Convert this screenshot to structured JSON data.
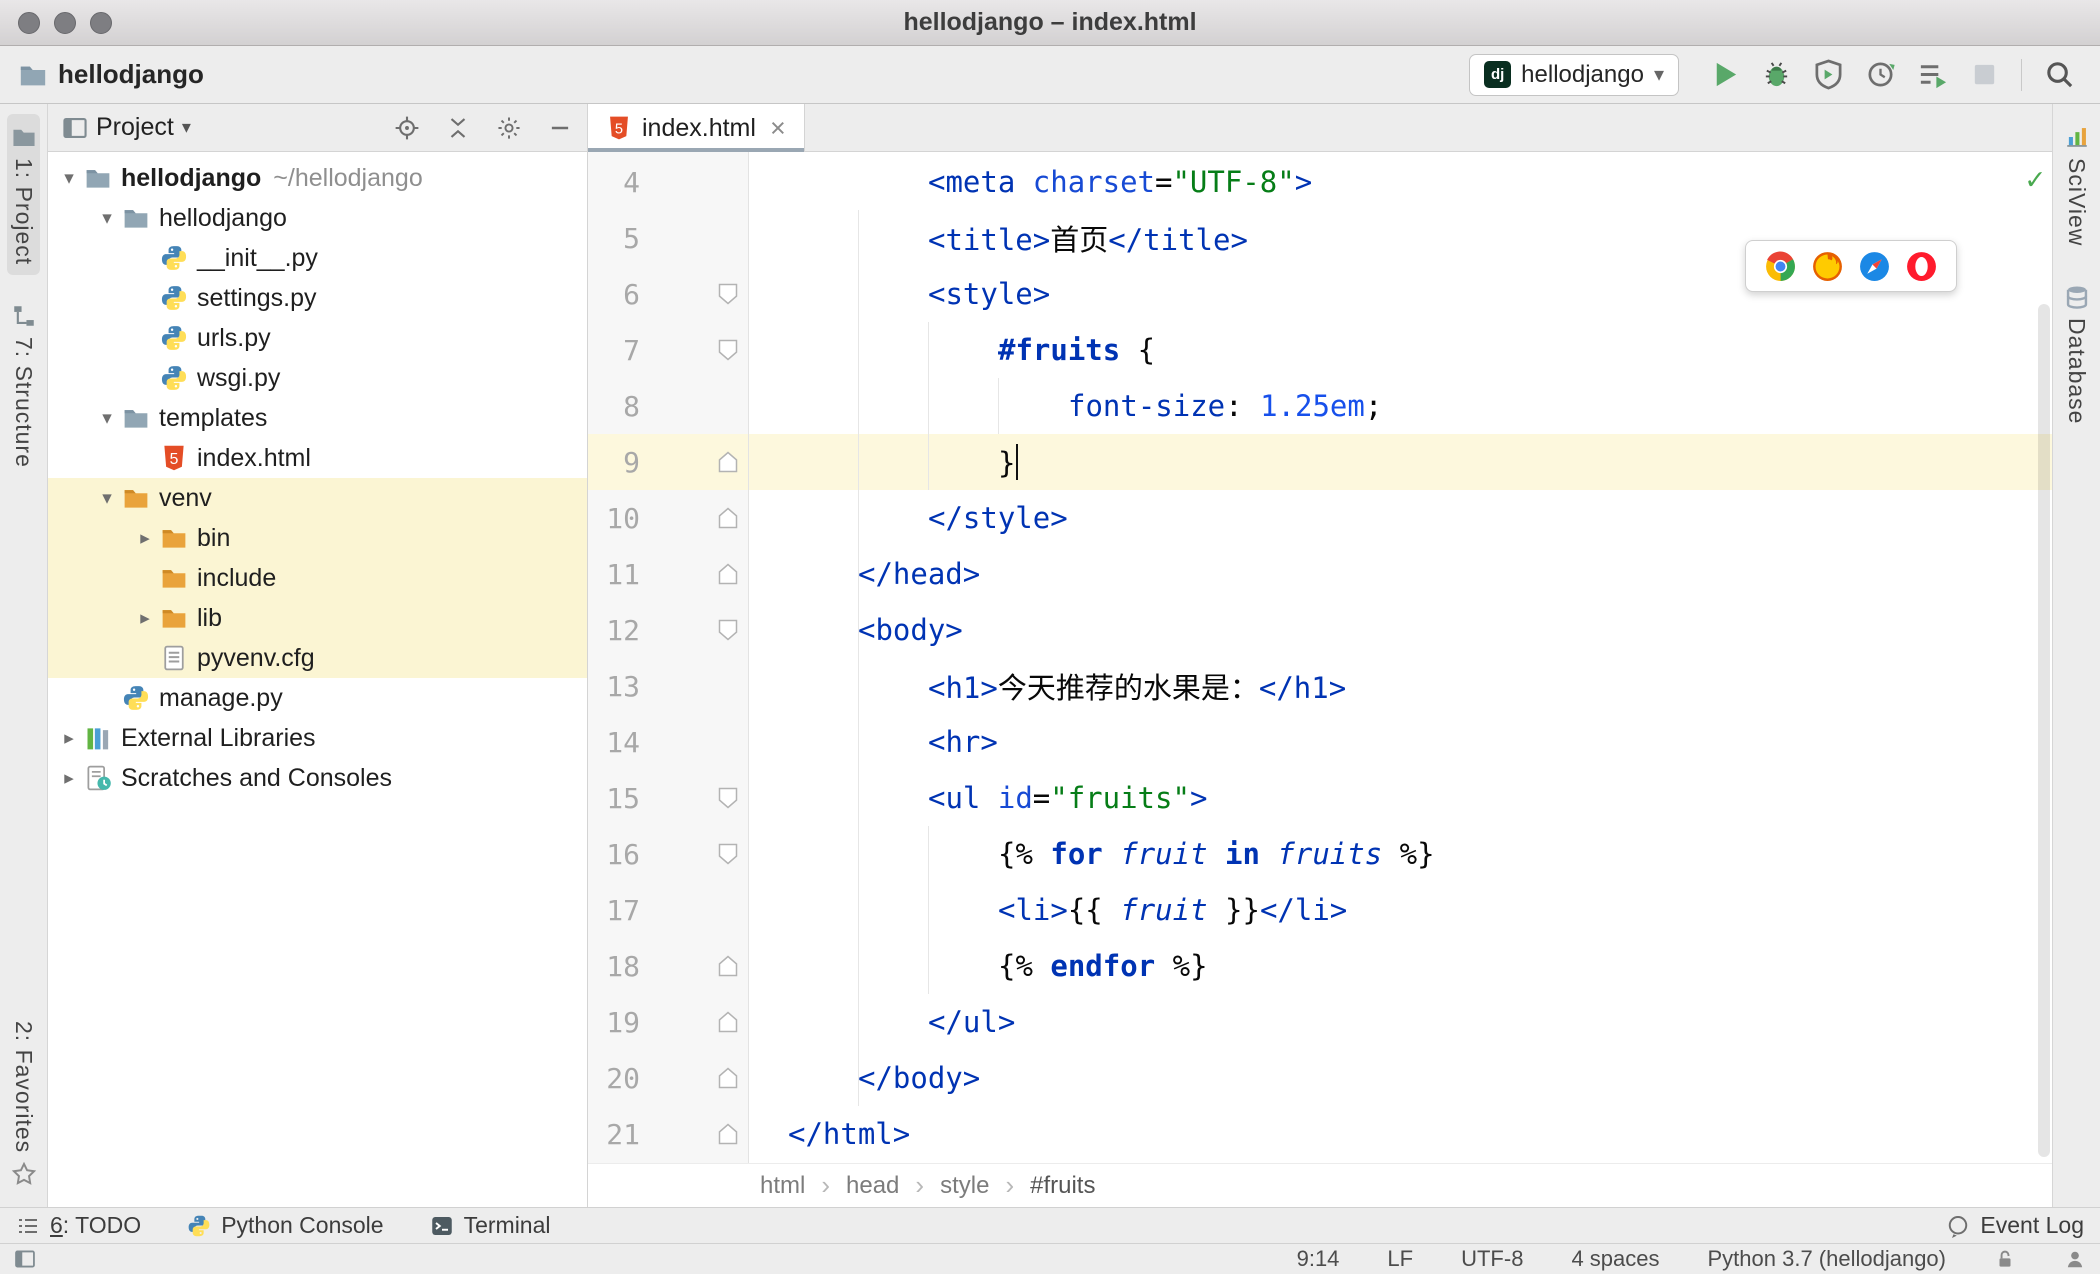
{
  "glyphs": {
    "close": "×",
    "caret_down": "▾",
    "check": "✓",
    "crumb_sep": "›",
    "arrow_expanded": "▾",
    "arrow_collapsed": "▸"
  },
  "window": {
    "title": "hellodjango – index.html"
  },
  "toolbar": {
    "project": "hellodjango",
    "run_config": {
      "badge": "dj",
      "name": "hellodjango"
    },
    "actions": [
      {
        "name": "run"
      },
      {
        "name": "debug"
      },
      {
        "name": "run-with-coverage"
      },
      {
        "name": "profiler"
      },
      {
        "name": "run-configurations"
      },
      {
        "name": "stop",
        "disabled": true
      },
      {
        "name": "separator"
      },
      {
        "name": "search-everywhere"
      }
    ]
  },
  "stripes": {
    "left": [
      {
        "icon": "project",
        "label": "1: Project",
        "active": true
      },
      {
        "icon": "structure",
        "label": "7: Structure"
      },
      {
        "icon": "favorites",
        "label": "2: Favorites",
        "bottom": true
      }
    ],
    "right": [
      {
        "icon": "sciview",
        "label": "SciView"
      },
      {
        "icon": "database",
        "label": "Database"
      }
    ]
  },
  "project_panel": {
    "header": "Project",
    "actions": [
      "locate",
      "collapse-all",
      "settings",
      "hide"
    ],
    "tree": [
      {
        "arrow": "down",
        "icon": "folder",
        "label": "hellodjango",
        "sub": "~/hellodjango",
        "level": 0,
        "bold": true
      },
      {
        "arrow": "down",
        "icon": "folder",
        "label": "hellodjango",
        "level": 1
      },
      {
        "icon": "py",
        "label": "__init__.py",
        "level": 2
      },
      {
        "icon": "py",
        "label": "settings.py",
        "level": 2
      },
      {
        "icon": "py",
        "label": "urls.py",
        "level": 2
      },
      {
        "icon": "py",
        "label": "wsgi.py",
        "level": 2
      },
      {
        "arrow": "down",
        "icon": "folder",
        "label": "templates",
        "level": 1
      },
      {
        "icon": "html",
        "label": "index.html",
        "level": 2
      },
      {
        "arrow": "down",
        "icon": "folder-ex",
        "label": "venv",
        "level": 1,
        "hl": true
      },
      {
        "arrow": "right",
        "icon": "folder-ex",
        "label": "bin",
        "level": 2,
        "hl": true
      },
      {
        "icon": "folder-ex",
        "label": "include",
        "level": 2,
        "hl": true
      },
      {
        "arrow": "right",
        "icon": "folder-ex",
        "label": "lib",
        "level": 2,
        "hl": true
      },
      {
        "icon": "cfg",
        "label": "pyvenv.cfg",
        "level": 2,
        "hl": true
      },
      {
        "icon": "py",
        "label": "manage.py",
        "level": 1
      },
      {
        "arrow": "right",
        "icon": "libs",
        "label": "External Libraries",
        "level": 0
      },
      {
        "arrow": "right",
        "icon": "scratch",
        "label": "Scratches and Consoles",
        "level": 0
      }
    ]
  },
  "editor": {
    "tab": {
      "label": "index.html"
    },
    "current_line": 9,
    "browsers": [
      "chrome",
      "firefox",
      "safari",
      "opera"
    ],
    "breadcrumbs": [
      "html",
      "head",
      "style",
      "#fruits"
    ],
    "lines": [
      {
        "num": 4,
        "indent": 2,
        "fold": null,
        "segs": [
          [
            "tag",
            "<meta"
          ],
          [
            "plain",
            " "
          ],
          [
            "attr",
            "charset"
          ],
          [
            "plain",
            "="
          ],
          [
            "val",
            "\"UTF-8\""
          ],
          [
            "tag",
            ">"
          ]
        ]
      },
      {
        "num": 5,
        "indent": 2,
        "fold": null,
        "segs": [
          [
            "tag",
            "<title>"
          ],
          [
            "plain",
            "首页"
          ],
          [
            "tag",
            "</title>"
          ]
        ]
      },
      {
        "num": 6,
        "indent": 2,
        "fold": "down",
        "segs": [
          [
            "tag",
            "<style>"
          ]
        ]
      },
      {
        "num": 7,
        "indent": 3,
        "fold": "down",
        "segs": [
          [
            "sel",
            "#fruits"
          ],
          [
            "plain",
            " {"
          ]
        ]
      },
      {
        "num": 8,
        "indent": 4,
        "fold": null,
        "segs": [
          [
            "prop",
            "font-size"
          ],
          [
            "plain",
            ": "
          ],
          [
            "num",
            "1.25em"
          ],
          [
            "plain",
            ";"
          ]
        ]
      },
      {
        "num": 9,
        "indent": 3,
        "fold": "up",
        "segs": [
          [
            "plain",
            "}"
          ]
        ]
      },
      {
        "num": 10,
        "indent": 2,
        "fold": "up",
        "segs": [
          [
            "tag",
            "</style>"
          ]
        ]
      },
      {
        "num": 11,
        "indent": 1,
        "fold": "up",
        "segs": [
          [
            "tag",
            "</head>"
          ]
        ]
      },
      {
        "num": 12,
        "indent": 1,
        "fold": "down",
        "segs": [
          [
            "tag",
            "<body>"
          ]
        ]
      },
      {
        "num": 13,
        "indent": 2,
        "fold": null,
        "segs": [
          [
            "tag",
            "<h1>"
          ],
          [
            "plain",
            "今天推荐的水果是："
          ],
          [
            "tag",
            "</h1>"
          ]
        ]
      },
      {
        "num": 14,
        "indent": 2,
        "fold": null,
        "segs": [
          [
            "tag",
            "<hr>"
          ]
        ]
      },
      {
        "num": 15,
        "indent": 2,
        "fold": "down",
        "segs": [
          [
            "tag",
            "<ul"
          ],
          [
            "plain",
            " "
          ],
          [
            "attr",
            "id"
          ],
          [
            "plain",
            "="
          ],
          [
            "val",
            "\"fruits\""
          ],
          [
            "tag",
            ">"
          ]
        ]
      },
      {
        "num": 16,
        "indent": 3,
        "fold": "down",
        "segs": [
          [
            "plain",
            "{% "
          ],
          [
            "kw",
            "for"
          ],
          [
            "plain",
            " "
          ],
          [
            "var",
            "fruit"
          ],
          [
            "plain",
            " "
          ],
          [
            "kw",
            "in"
          ],
          [
            "plain",
            " "
          ],
          [
            "var",
            "fruits"
          ],
          [
            "plain",
            " %}"
          ]
        ]
      },
      {
        "num": 17,
        "indent": 3,
        "fold": null,
        "segs": [
          [
            "tag",
            "<li>"
          ],
          [
            "plain",
            "{{ "
          ],
          [
            "var",
            "fruit"
          ],
          [
            "plain",
            " }}"
          ],
          [
            "tag",
            "</li>"
          ]
        ]
      },
      {
        "num": 18,
        "indent": 3,
        "fold": "up",
        "segs": [
          [
            "plain",
            "{% "
          ],
          [
            "kw",
            "endfor"
          ],
          [
            "plain",
            " %}"
          ]
        ]
      },
      {
        "num": 19,
        "indent": 2,
        "fold": "up",
        "segs": [
          [
            "tag",
            "</ul>"
          ]
        ]
      },
      {
        "num": 20,
        "indent": 1,
        "fold": "up",
        "segs": [
          [
            "tag",
            "</body>"
          ]
        ]
      },
      {
        "num": 21,
        "indent": 0,
        "fold": "up",
        "segs": [
          [
            "tag",
            "</html>"
          ]
        ]
      }
    ]
  },
  "bottombar": {
    "items": [
      {
        "icon": "todo",
        "label": "6: TODO",
        "mnemonic": "6"
      },
      {
        "icon": "py",
        "label": "Python Console"
      },
      {
        "icon": "terminal",
        "label": "Terminal"
      }
    ],
    "right": {
      "icon": "event-log",
      "label": "Event Log"
    }
  },
  "statusbar": {
    "items": [
      "9:14",
      "LF",
      "UTF-8",
      "4 spaces",
      "Python 3.7 (hellodjango)"
    ],
    "icons": [
      "lock",
      "hector"
    ]
  },
  "colors": {
    "accent_blue": "#0033b3",
    "string_green": "#067d17",
    "folder_excluded": "#e8a23c",
    "run_green": "#59a869",
    "django_badge": "#092e20",
    "editor_current_line": "#fdf8dd",
    "tree_highlight": "#fbf5d3"
  }
}
